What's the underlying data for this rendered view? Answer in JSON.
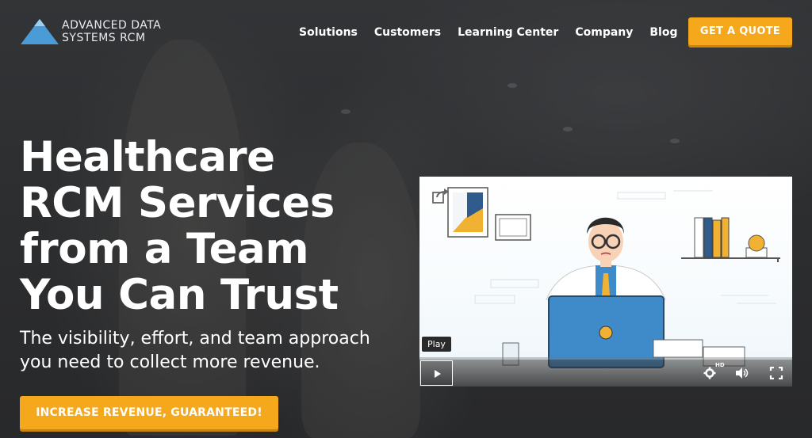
{
  "brand": {
    "name_line1": "ADVANCED DATA",
    "name_line2": "SYSTEMS RCM",
    "logo_color": "#4a9bd6"
  },
  "nav": {
    "items": [
      "Solutions",
      "Customers",
      "Learning Center",
      "Company",
      "Blog"
    ],
    "icons": [
      "search-icon",
      "phone-icon"
    ],
    "cta_label": "GET A QUOTE"
  },
  "hero": {
    "title": "Healthcare RCM Services from a Team You Can Trust",
    "subtitle": "The visibility, effort, and team approach you need to collect more revenue.",
    "cta_label": "INCREASE REVENUE, GUARANTEED!"
  },
  "video": {
    "tooltip": "Play",
    "hd_label": "HD",
    "controls": [
      "play-icon",
      "gear-icon",
      "volume-icon",
      "fullscreen-icon"
    ],
    "share_icon": "share-icon"
  },
  "colors": {
    "accent": "#f5a81c",
    "accent_shadow": "#c9850e",
    "laptop_blue": "#3f8bc9",
    "text": "#ffffff"
  }
}
